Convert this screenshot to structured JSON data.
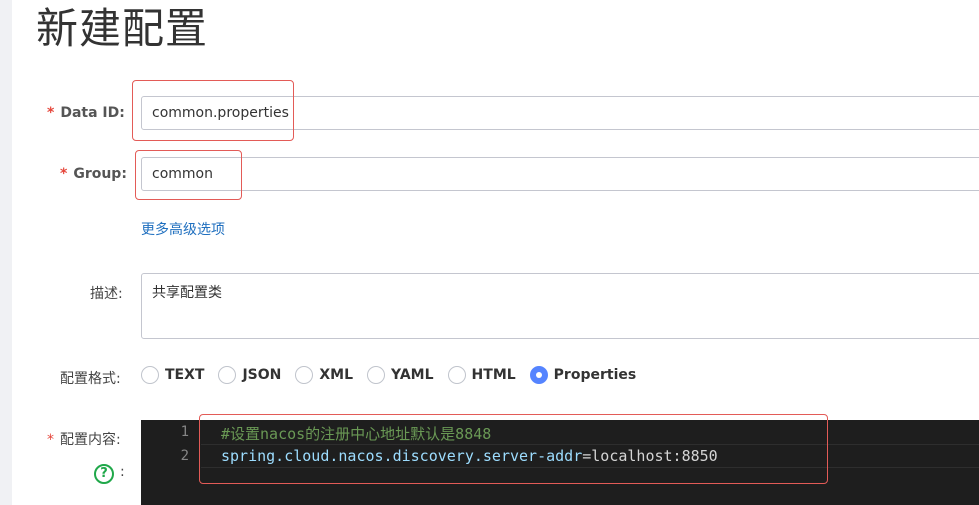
{
  "page": {
    "title": "新建配置"
  },
  "form": {
    "data_id": {
      "label": "Data ID:",
      "value": "common.properties",
      "required": true
    },
    "group": {
      "label": "Group:",
      "value": "common",
      "required": true
    },
    "advanced_link": "更多高级选项",
    "description": {
      "label": "描述:",
      "value": "共享配置类"
    },
    "format": {
      "label": "配置格式:",
      "options": [
        "TEXT",
        "JSON",
        "XML",
        "YAML",
        "HTML",
        "Properties"
      ],
      "selected": "Properties"
    },
    "content": {
      "label": "配置内容:",
      "help_glyph": "?",
      "help_suffix": ":",
      "line_numbers": [
        "1",
        "2"
      ],
      "line1_comment": "#设置nacos的注册中心地址默认是8848",
      "line2_key": "spring.cloud.nacos.discovery.server-addr",
      "line2_op": "=",
      "line2_value": "localhost:8850"
    }
  },
  "colors": {
    "required_star": "#e5453a",
    "highlight_box": "#e35b57",
    "link": "#1f6fbf",
    "radio_selected": "#5584ff",
    "help_icon": "#20a84a",
    "editor_bg": "#1e1e1e"
  }
}
